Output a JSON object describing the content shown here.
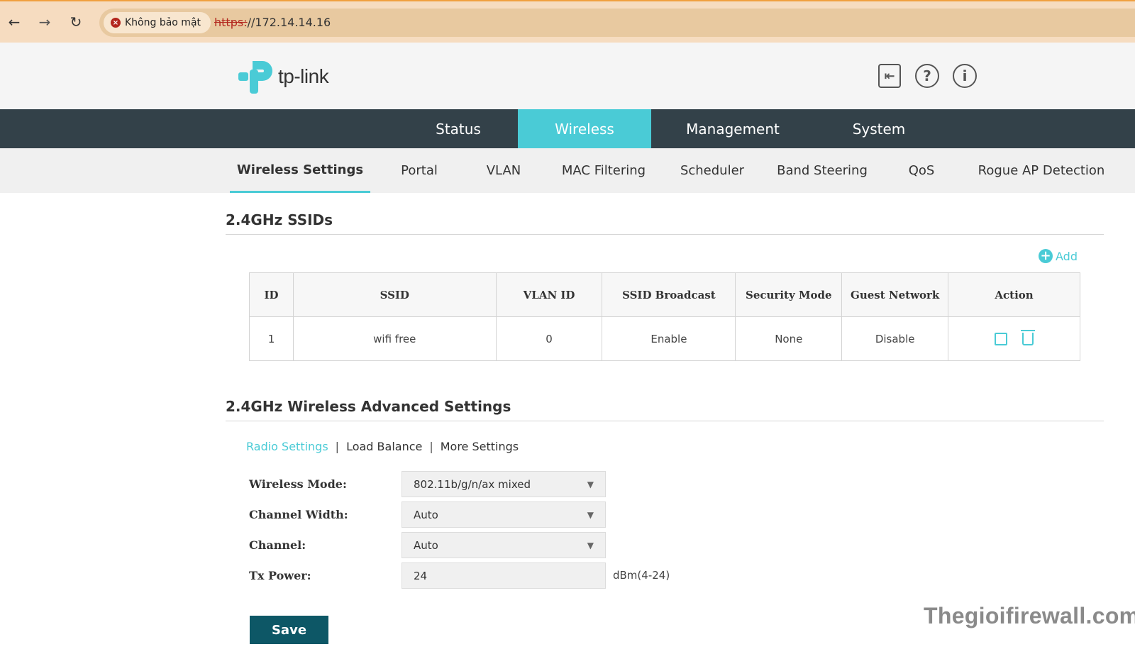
{
  "browser": {
    "security_label": "Không bảo mật",
    "url_scheme": "https:",
    "url_rest": "//172.14.14.16"
  },
  "header": {
    "logo_text": "tp-link",
    "brand_color": "#4acbd6"
  },
  "main_nav": {
    "tabs": [
      {
        "label": "Status"
      },
      {
        "label": "Wireless"
      },
      {
        "label": "Management"
      },
      {
        "label": "System"
      }
    ]
  },
  "sub_nav": {
    "tabs": [
      {
        "label": "Wireless Settings"
      },
      {
        "label": "Portal"
      },
      {
        "label": "VLAN"
      },
      {
        "label": "MAC Filtering"
      },
      {
        "label": "Scheduler"
      },
      {
        "label": "Band Steering"
      },
      {
        "label": "QoS"
      },
      {
        "label": "Rogue AP Detection"
      }
    ]
  },
  "ssids": {
    "title": "2.4GHz SSIDs",
    "add_label": "Add",
    "columns": [
      "ID",
      "SSID",
      "VLAN ID",
      "SSID Broadcast",
      "Security Mode",
      "Guest Network",
      "Action"
    ],
    "rows": [
      {
        "id": "1",
        "ssid": "wifi free",
        "vlan_id": "0",
        "broadcast": "Enable",
        "security": "None",
        "guest": "Disable"
      }
    ]
  },
  "advanced": {
    "title": "2.4GHz Wireless Advanced Settings",
    "links": [
      "Radio Settings",
      "Load Balance",
      "More Settings"
    ],
    "separator": "|",
    "fields": {
      "wireless_mode": {
        "label": "Wireless Mode:",
        "value": "802.11b/g/n/ax mixed"
      },
      "channel_width": {
        "label": "Channel Width:",
        "value": "Auto"
      },
      "channel": {
        "label": "Channel:",
        "value": "Auto"
      },
      "tx_power": {
        "label": "Tx Power:",
        "value": "24",
        "unit": "dBm(4-24)"
      }
    },
    "save_label": "Save"
  },
  "watermark": "Thegioifirewall.com"
}
